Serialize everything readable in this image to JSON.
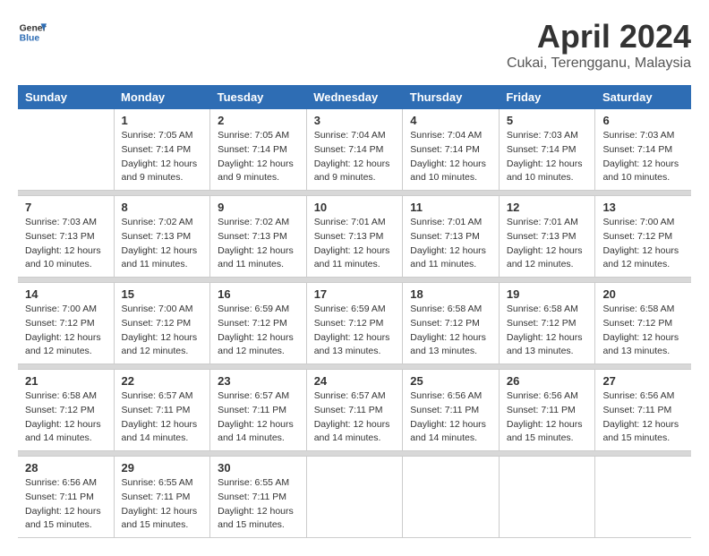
{
  "header": {
    "logo_line1": "General",
    "logo_line2": "Blue",
    "month": "April 2024",
    "location": "Cukai, Terengganu, Malaysia"
  },
  "weekdays": [
    "Sunday",
    "Monday",
    "Tuesday",
    "Wednesday",
    "Thursday",
    "Friday",
    "Saturday"
  ],
  "weeks": [
    [
      {
        "day": "",
        "info": ""
      },
      {
        "day": "1",
        "info": "Sunrise: 7:05 AM\nSunset: 7:14 PM\nDaylight: 12 hours\nand 9 minutes."
      },
      {
        "day": "2",
        "info": "Sunrise: 7:05 AM\nSunset: 7:14 PM\nDaylight: 12 hours\nand 9 minutes."
      },
      {
        "day": "3",
        "info": "Sunrise: 7:04 AM\nSunset: 7:14 PM\nDaylight: 12 hours\nand 9 minutes."
      },
      {
        "day": "4",
        "info": "Sunrise: 7:04 AM\nSunset: 7:14 PM\nDaylight: 12 hours\nand 10 minutes."
      },
      {
        "day": "5",
        "info": "Sunrise: 7:03 AM\nSunset: 7:14 PM\nDaylight: 12 hours\nand 10 minutes."
      },
      {
        "day": "6",
        "info": "Sunrise: 7:03 AM\nSunset: 7:14 PM\nDaylight: 12 hours\nand 10 minutes."
      }
    ],
    [
      {
        "day": "7",
        "info": "Sunrise: 7:03 AM\nSunset: 7:13 PM\nDaylight: 12 hours\nand 10 minutes."
      },
      {
        "day": "8",
        "info": "Sunrise: 7:02 AM\nSunset: 7:13 PM\nDaylight: 12 hours\nand 11 minutes."
      },
      {
        "day": "9",
        "info": "Sunrise: 7:02 AM\nSunset: 7:13 PM\nDaylight: 12 hours\nand 11 minutes."
      },
      {
        "day": "10",
        "info": "Sunrise: 7:01 AM\nSunset: 7:13 PM\nDaylight: 12 hours\nand 11 minutes."
      },
      {
        "day": "11",
        "info": "Sunrise: 7:01 AM\nSunset: 7:13 PM\nDaylight: 12 hours\nand 11 minutes."
      },
      {
        "day": "12",
        "info": "Sunrise: 7:01 AM\nSunset: 7:13 PM\nDaylight: 12 hours\nand 12 minutes."
      },
      {
        "day": "13",
        "info": "Sunrise: 7:00 AM\nSunset: 7:12 PM\nDaylight: 12 hours\nand 12 minutes."
      }
    ],
    [
      {
        "day": "14",
        "info": "Sunrise: 7:00 AM\nSunset: 7:12 PM\nDaylight: 12 hours\nand 12 minutes."
      },
      {
        "day": "15",
        "info": "Sunrise: 7:00 AM\nSunset: 7:12 PM\nDaylight: 12 hours\nand 12 minutes."
      },
      {
        "day": "16",
        "info": "Sunrise: 6:59 AM\nSunset: 7:12 PM\nDaylight: 12 hours\nand 12 minutes."
      },
      {
        "day": "17",
        "info": "Sunrise: 6:59 AM\nSunset: 7:12 PM\nDaylight: 12 hours\nand 13 minutes."
      },
      {
        "day": "18",
        "info": "Sunrise: 6:58 AM\nSunset: 7:12 PM\nDaylight: 12 hours\nand 13 minutes."
      },
      {
        "day": "19",
        "info": "Sunrise: 6:58 AM\nSunset: 7:12 PM\nDaylight: 12 hours\nand 13 minutes."
      },
      {
        "day": "20",
        "info": "Sunrise: 6:58 AM\nSunset: 7:12 PM\nDaylight: 12 hours\nand 13 minutes."
      }
    ],
    [
      {
        "day": "21",
        "info": "Sunrise: 6:58 AM\nSunset: 7:12 PM\nDaylight: 12 hours\nand 14 minutes."
      },
      {
        "day": "22",
        "info": "Sunrise: 6:57 AM\nSunset: 7:11 PM\nDaylight: 12 hours\nand 14 minutes."
      },
      {
        "day": "23",
        "info": "Sunrise: 6:57 AM\nSunset: 7:11 PM\nDaylight: 12 hours\nand 14 minutes."
      },
      {
        "day": "24",
        "info": "Sunrise: 6:57 AM\nSunset: 7:11 PM\nDaylight: 12 hours\nand 14 minutes."
      },
      {
        "day": "25",
        "info": "Sunrise: 6:56 AM\nSunset: 7:11 PM\nDaylight: 12 hours\nand 14 minutes."
      },
      {
        "day": "26",
        "info": "Sunrise: 6:56 AM\nSunset: 7:11 PM\nDaylight: 12 hours\nand 15 minutes."
      },
      {
        "day": "27",
        "info": "Sunrise: 6:56 AM\nSunset: 7:11 PM\nDaylight: 12 hours\nand 15 minutes."
      }
    ],
    [
      {
        "day": "28",
        "info": "Sunrise: 6:56 AM\nSunset: 7:11 PM\nDaylight: 12 hours\nand 15 minutes."
      },
      {
        "day": "29",
        "info": "Sunrise: 6:55 AM\nSunset: 7:11 PM\nDaylight: 12 hours\nand 15 minutes."
      },
      {
        "day": "30",
        "info": "Sunrise: 6:55 AM\nSunset: 7:11 PM\nDaylight: 12 hours\nand 15 minutes."
      },
      {
        "day": "",
        "info": ""
      },
      {
        "day": "",
        "info": ""
      },
      {
        "day": "",
        "info": ""
      },
      {
        "day": "",
        "info": ""
      }
    ]
  ]
}
